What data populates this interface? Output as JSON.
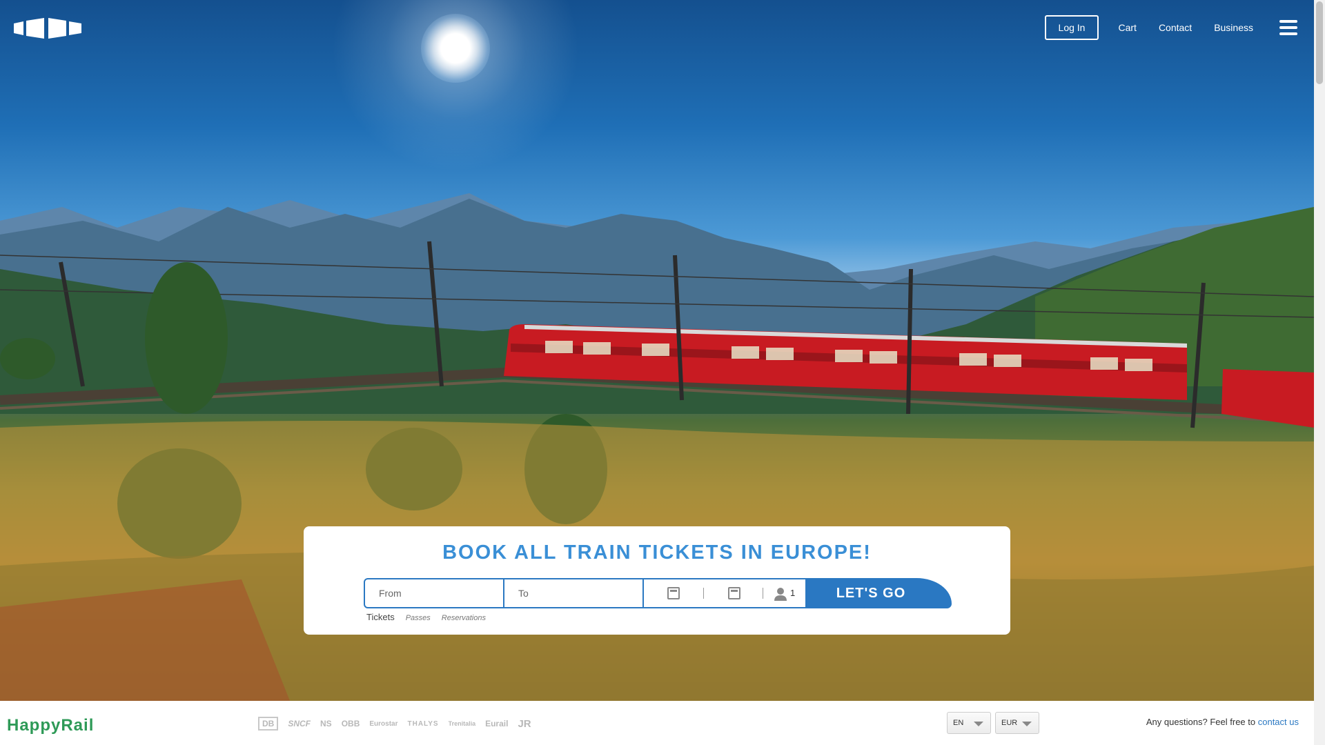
{
  "nav": {
    "login": "Log In",
    "links": [
      "Cart",
      "Contact",
      "Business"
    ]
  },
  "booking": {
    "title": "BOOK ALL TRAIN TICKETS IN EUROPE!",
    "from_placeholder": "From",
    "to_placeholder": "To",
    "passengers": "1",
    "submit": "LET'S GO",
    "modes": {
      "tickets": "Tickets",
      "passes": "Passes",
      "reservations": "Reservations"
    }
  },
  "footer": {
    "brand": "HappyRail",
    "partners": [
      "DB",
      "SNCF",
      "NS",
      "OBB",
      "Eurostar",
      "THALYS",
      "Trenitalia",
      "Eurail",
      "JR"
    ],
    "language": "EN",
    "currency": "EUR",
    "help_text": "Any questions? Feel free to",
    "help_link": "contact us"
  },
  "colors": {
    "accent": "#2a78c2",
    "title": "#3a8fd6",
    "brand": "#2e9a57"
  }
}
